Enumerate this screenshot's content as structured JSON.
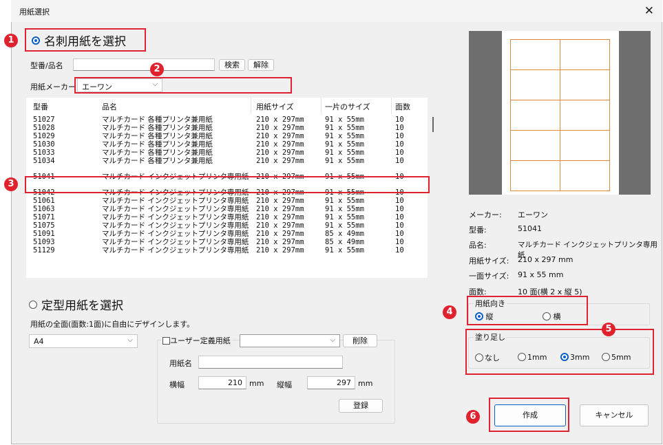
{
  "dialog": {
    "title": "用紙選択",
    "close_label": "✕"
  },
  "section1": {
    "radio_label": "名刺用紙を選択",
    "search_label": "型番/品名",
    "search_value": "",
    "search_button": "検索",
    "clear_button": "解除",
    "maker_label": "用紙メーカー",
    "maker_value": "エーワン"
  },
  "table": {
    "headers": [
      "型番",
      "品名",
      "用紙サイズ",
      "一片のサイズ",
      "面数"
    ],
    "rows": [
      [
        "51027",
        "マルチカード 各種プリンタ兼用紙",
        "210 x 297mm",
        "91 x 55mm",
        "10"
      ],
      [
        "51028",
        "マルチカード 各種プリンタ兼用紙",
        "210 x 297mm",
        "91 x 55mm",
        "10"
      ],
      [
        "51029",
        "マルチカード 各種プリンタ兼用紙",
        "210 x 297mm",
        "91 x 55mm",
        "10"
      ],
      [
        "51030",
        "マルチカード 各種プリンタ兼用紙",
        "210 x 297mm",
        "91 x 55mm",
        "10"
      ],
      [
        "51033",
        "マルチカード 各種プリンタ兼用紙",
        "210 x 297mm",
        "91 x 55mm",
        "10"
      ],
      [
        "51034",
        "マルチカード 各種プリンタ兼用紙",
        "210 x 297mm",
        "91 x 55mm",
        "10"
      ],
      [
        "51041",
        "マルチカード インクジェットプリンタ専用紙",
        "210 x 297mm",
        "91 x 55mm",
        "10"
      ],
      [
        "51042",
        "マルチカード インクジェットプリンタ専用紙",
        "210 x 297mm",
        "91 x 55mm",
        "10"
      ],
      [
        "51061",
        "マルチカード インクジェットプリンタ専用紙",
        "210 x 297mm",
        "91 x 55mm",
        "10"
      ],
      [
        "51063",
        "マルチカード インクジェットプリンタ専用紙",
        "210 x 297mm",
        "91 x 55mm",
        "10"
      ],
      [
        "51071",
        "マルチカード インクジェットプリンタ専用紙",
        "210 x 297mm",
        "91 x 55mm",
        "10"
      ],
      [
        "51075",
        "マルチカード インクジェットプリンタ専用紙",
        "210 x 297mm",
        "91 x 55mm",
        "10"
      ],
      [
        "51091",
        "マルチカード インクジェットプリンタ専用紙",
        "210 x 297mm",
        "85 x 49mm",
        "10"
      ],
      [
        "51093",
        "マルチカード インクジェットプリンタ専用紙",
        "210 x 297mm",
        "85 x 49mm",
        "10"
      ],
      [
        "51129",
        "マルチカード インクジェットプリンタ専用紙",
        "210 x 297mm",
        "91 x 55mm",
        "10"
      ]
    ],
    "selected_index": 6
  },
  "section2": {
    "radio_label": "定型用紙を選択",
    "description": "用紙の全面(面数:1面)に自由にデザインします。",
    "size_value": "A4",
    "user_paper_label": "ユーザー定義用紙",
    "delete_button": "削除",
    "name_label": "用紙名",
    "name_value": "",
    "width_label": "横幅",
    "width_value": "210",
    "width_unit": "mm",
    "height_label": "縦幅",
    "height_value": "297",
    "height_unit": "mm",
    "register_button": "登録"
  },
  "info": {
    "maker_label": "メーカー:",
    "maker_value": "エーワン",
    "model_label": "型番:",
    "model_value": "51041",
    "name_label": "品名:",
    "name_value": "マルチカード インクジェットプリンタ専用紙",
    "size_label": "用紙サイズ:",
    "size_value": "210 x 297 mm",
    "piece_label": "一面サイズ:",
    "piece_value": "91 x 55 mm",
    "faces_label": "面数:",
    "faces_value": "10 面(横 2 x 縦 5)"
  },
  "orientation": {
    "label": "用紙向き",
    "portrait": "縦",
    "landscape": "横",
    "selected": "portrait"
  },
  "bleed": {
    "label": "塗り足し",
    "options": [
      "なし",
      "1mm",
      "3mm",
      "5mm"
    ],
    "selected": 2
  },
  "buttons": {
    "create": "作成",
    "cancel": "キャンセル"
  },
  "badges": [
    "1",
    "2",
    "3",
    "4",
    "5",
    "6"
  ],
  "colors": {
    "accent": "#0a5fc4",
    "annotation_red": "#e0222f",
    "cell_border": "#e08a3a"
  }
}
